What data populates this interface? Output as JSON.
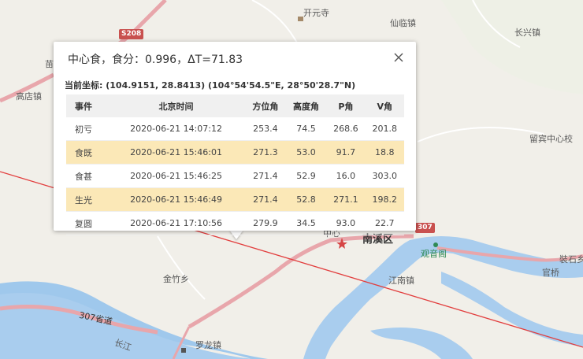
{
  "popup": {
    "title": "中心食，食分：0.996，ΔT=71.83",
    "coordinates": "当前坐标: (104.9151, 28.8413) (104°54'54.5\"E, 28°50'28.7\"N)",
    "headers": [
      "事件",
      "北京时间",
      "方位角",
      "高度角",
      "P角",
      "V角"
    ],
    "rows": [
      {
        "event": "初亏",
        "time": "2020-06-21 14:07:12",
        "azimuth": "253.4",
        "altitude": "74.5",
        "p_angle": "268.6",
        "v_angle": "201.8",
        "highlighted": false
      },
      {
        "event": "食既",
        "time": "2020-06-21 15:46:01",
        "azimuth": "271.3",
        "altitude": "53.0",
        "p_angle": "91.7",
        "v_angle": "18.8",
        "highlighted": true
      },
      {
        "event": "食甚",
        "time": "2020-06-21 15:46:25",
        "azimuth": "271.4",
        "altitude": "52.9",
        "p_angle": "16.0",
        "v_angle": "303.0",
        "highlighted": false
      },
      {
        "event": "生光",
        "time": "2020-06-21 15:46:49",
        "azimuth": "271.4",
        "altitude": "52.8",
        "p_angle": "271.1",
        "v_angle": "198.2",
        "highlighted": true
      },
      {
        "event": "复圆",
        "time": "2020-06-21 17:10:56",
        "azimuth": "279.9",
        "altitude": "34.5",
        "p_angle": "93.0",
        "v_angle": "22.7",
        "highlighted": false
      }
    ]
  },
  "map": {
    "labels": {
      "kaiyuansi": "开元寺",
      "xianlinzhen": "仙临镇",
      "changxingzhen": "长兴镇",
      "gaodianzhen": "高店镇",
      "miao": "苗",
      "liubinzhongxinxiao": "留宾中心校",
      "zhongxin": "中心",
      "nanxiqu": "南溪区",
      "guanyinge": "观音阁",
      "jiangnanzhen": "江南镇",
      "jinzhuxiang": "金竹乡",
      "guanqiao": "官桥",
      "zhuangshi": "裝石乡",
      "luolongzhen": "罗龙镇",
      "changjiang": "长江",
      "road_307": "307省道"
    },
    "shields": {
      "s208": "S208",
      "s307": "307"
    }
  }
}
